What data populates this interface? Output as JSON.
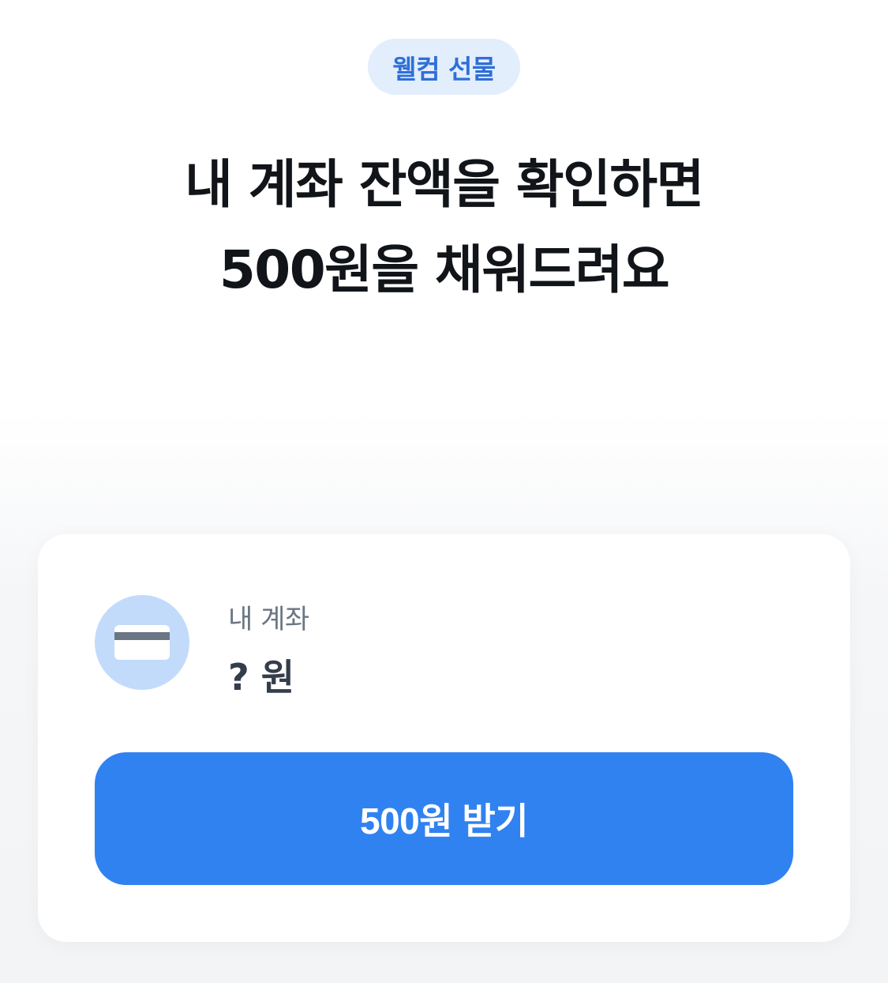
{
  "badge": {
    "label": "웰컴 선물"
  },
  "headline": {
    "line1": "내 계좌 잔액을 확인하면",
    "line2": "500원을 채워드려요"
  },
  "account": {
    "label": "내 계좌",
    "balance": "? 원",
    "icon": "card-icon"
  },
  "cta": {
    "label": "500원 받기"
  },
  "colors": {
    "accent": "#3182f1",
    "badge_bg": "#e3eefc",
    "badge_text": "#2f6fd8",
    "icon_bg": "#c3dbfb"
  }
}
